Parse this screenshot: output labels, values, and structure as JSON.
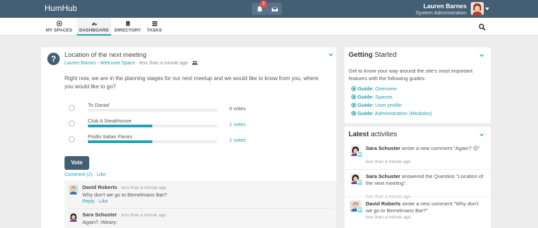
{
  "topbar": {
    "brand": "HumHub",
    "notification_count": "3",
    "user_name": "Lauren Barnes",
    "user_title": "System Administration"
  },
  "nav": {
    "items": [
      {
        "label": "MY SPACES",
        "icon": "dot-circle-icon"
      },
      {
        "label": "DASHBOARD",
        "icon": "tachometer-icon"
      },
      {
        "label": "DIRECTORY",
        "icon": "book-icon"
      },
      {
        "label": "TASKS",
        "icon": "tasks-icon"
      }
    ],
    "active": "DASHBOARD"
  },
  "post": {
    "title": "Location of the next meeting",
    "author": "Lauren Barnes",
    "space": "Welcome Space",
    "time": "less than a minute ago",
    "body": "Right now, we are in the planning stages for our next meetup and we would like to know from you, where you would like to go?",
    "options": [
      {
        "label": "To Daniel",
        "votes_text": "0 votes",
        "fraction": 0.0
      },
      {
        "label": "Club A Steakhouse",
        "votes_text": "1 votes",
        "fraction": 0.5
      },
      {
        "label": "Pisillo Italian Panini",
        "votes_text": "1 votes",
        "fraction": 0.5
      }
    ],
    "vote_label": "Vote",
    "comment_link": "Comment (2)",
    "like_link": "Like"
  },
  "comments": [
    {
      "author": "David Roberts",
      "time": "less than a minute ago",
      "text": "Why don't we go to Bemelmans Bar?",
      "reply": "Reply",
      "like": "Like"
    },
    {
      "author": "Sara Schuster",
      "time": "less than a minute ago",
      "text": "Again? ;Weary:"
    }
  ],
  "getting_started": {
    "title_bold": "Getting",
    "title_rest": " Started",
    "intro": "Get to know your way around the site's most important features with the following guides:",
    "guide_prefix": "Guide:",
    "guides": [
      "Overview",
      "Spaces",
      "User profile",
      "Administration (Modules)"
    ]
  },
  "activities": {
    "title_bold": "Latest",
    "title_rest": " activities",
    "space_badge": "WS",
    "items": [
      {
        "author": "Sara Schuster",
        "action": " wrote a new comment \"Again? ☹\"",
        "time": "less than a minute ago"
      },
      {
        "author": "Sara Schuster",
        "action": " answered the Question \"Location of the next meeting\".",
        "time": "less than a minute ago"
      },
      {
        "author": "David Roberts",
        "action": " wrote a new comment \"Why don't we go to Bemelmans Bar?\"",
        "time": "less than a minute ago"
      }
    ]
  },
  "colors": {
    "topbar": "#435f73",
    "accent": "#21a1b3",
    "badge": "#d9534f"
  }
}
